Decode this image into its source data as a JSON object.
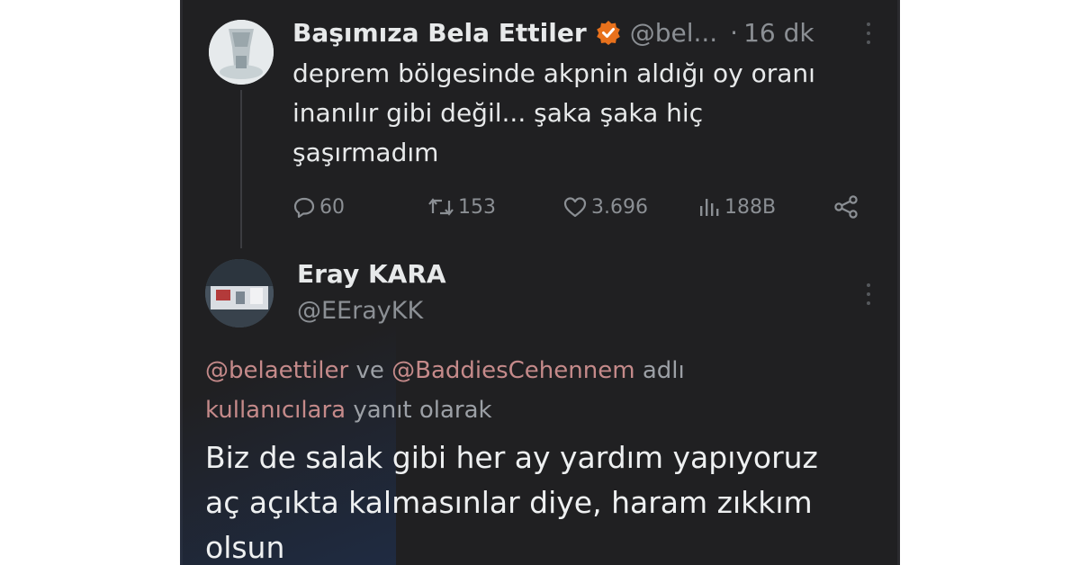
{
  "tweet": {
    "author": "Başımıza Bela Ettiler",
    "handle": "@bel...",
    "time_separator": "·",
    "time": "16 dk",
    "text_lines": [
      "deprem bölgesinde akpnin aldığı oy oranı",
      "inanılır gibi değil... şaka şaka hiç",
      "şaşırmadım"
    ],
    "stats": {
      "replies": "60",
      "retweets": "153",
      "likes": "3.696",
      "views": "188B"
    }
  },
  "reply": {
    "author": "Eray KARA",
    "handle": "@EErayKK",
    "reply_to": {
      "mention_1": "@belaettiler",
      "connector": "ve",
      "mention_2": "@BaddiesCehennem",
      "suffix_1": "adlı",
      "line2_mention": "kullanıcılara",
      "line2_suffix": "yanıt olarak"
    },
    "text_lines": [
      "Biz de salak gibi her ay yardım yapıyoruz",
      "aç açıkta kalmasınlar diye, haram zıkkım",
      "olsun"
    ]
  },
  "colors": {
    "background": "#202022",
    "text": "#e7e9ea",
    "muted": "#8b8f94",
    "mention": "#c58a8a",
    "verified_badge": "#e8711c"
  },
  "icons": {
    "verified": "verified-badge-icon",
    "more": "more-options-icon",
    "reply": "reply-icon",
    "retweet": "retweet-icon",
    "like": "heart-icon",
    "views": "views-icon",
    "share": "share-icon"
  }
}
